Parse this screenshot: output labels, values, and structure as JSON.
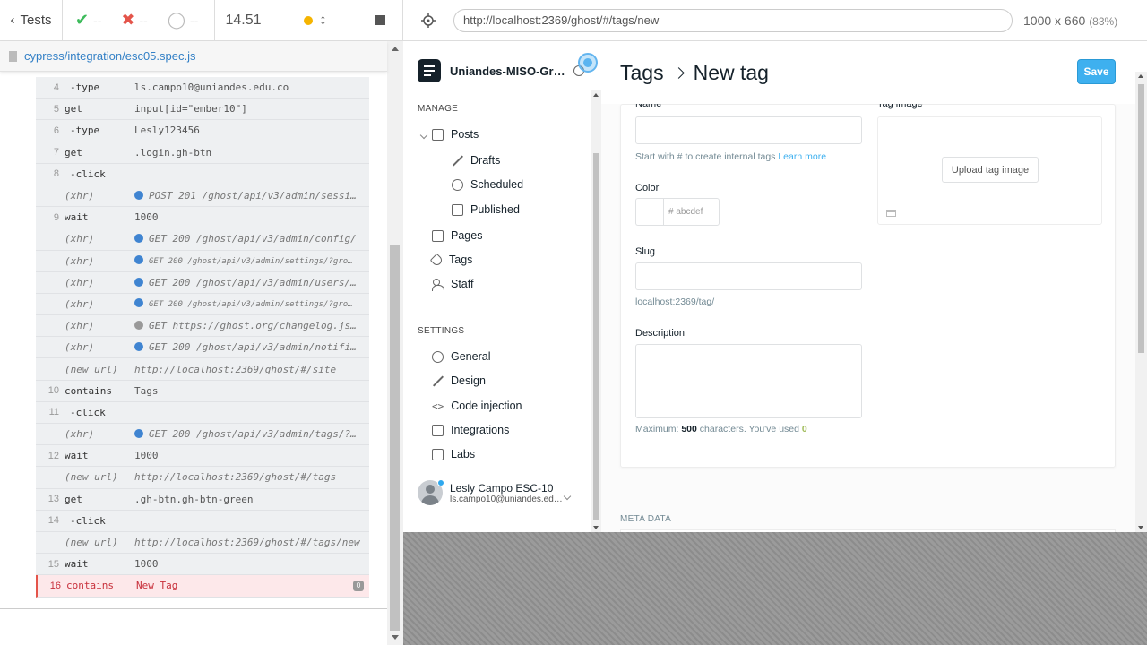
{
  "runner": {
    "tests_label": "Tests",
    "passed": "--",
    "failed": "--",
    "pending": "--",
    "duration": "14.51",
    "spec_path": "cypress/integration/esc05.spec.js"
  },
  "commands": [
    {
      "num": "4",
      "name": "-type",
      "msg": "ls.campo10@uniandes.edu.co",
      "kind": "child"
    },
    {
      "num": "5",
      "name": "get",
      "msg": "input[id=\"ember10\"]",
      "kind": "cmd"
    },
    {
      "num": "6",
      "name": "-type",
      "msg": "Lesly123456",
      "kind": "child"
    },
    {
      "num": "7",
      "name": "get",
      "msg": ".login.gh-btn",
      "kind": "cmd"
    },
    {
      "num": "8",
      "name": "-click",
      "msg": "",
      "kind": "child"
    },
    {
      "num": "",
      "name": "(xhr)",
      "msg": "POST 201 /ghost/api/v3/admin/sessi…",
      "kind": "xhr",
      "dot": "blue"
    },
    {
      "num": "9",
      "name": "wait",
      "msg": "1000",
      "kind": "cmd"
    },
    {
      "num": "",
      "name": "(xhr)",
      "msg": "GET 200 /ghost/api/v3/admin/config/",
      "kind": "xhr",
      "dot": "blue"
    },
    {
      "num": "",
      "name": "(xhr)",
      "msg": "GET 200 /ghost/api/v3/admin/settings/?gro…",
      "kind": "xhr-small",
      "dot": "blue"
    },
    {
      "num": "",
      "name": "(xhr)",
      "msg": "GET 200 /ghost/api/v3/admin/users/…",
      "kind": "xhr",
      "dot": "blue"
    },
    {
      "num": "",
      "name": "(xhr)",
      "msg": "GET 200 /ghost/api/v3/admin/settings/?gro…",
      "kind": "xhr-small",
      "dot": "blue"
    },
    {
      "num": "",
      "name": "(xhr)",
      "msg": "GET https://ghost.org/changelog.js…",
      "kind": "xhr",
      "dot": "gray"
    },
    {
      "num": "",
      "name": "(xhr)",
      "msg": "GET 200 /ghost/api/v3/admin/notifi…",
      "kind": "xhr",
      "dot": "blue"
    },
    {
      "num": "",
      "name": "(new url)",
      "msg": "http://localhost:2369/ghost/#/site",
      "kind": "url"
    },
    {
      "num": "10",
      "name": "contains",
      "msg": "Tags",
      "kind": "cmd"
    },
    {
      "num": "11",
      "name": "-click",
      "msg": "",
      "kind": "child"
    },
    {
      "num": "",
      "name": "(xhr)",
      "msg": "GET 200 /ghost/api/v3/admin/tags/?…",
      "kind": "xhr",
      "dot": "blue"
    },
    {
      "num": "12",
      "name": "wait",
      "msg": "1000",
      "kind": "cmd"
    },
    {
      "num": "",
      "name": "(new url)",
      "msg": "http://localhost:2369/ghost/#/tags",
      "kind": "url"
    },
    {
      "num": "13",
      "name": "get",
      "msg": ".gh-btn.gh-btn-green",
      "kind": "cmd"
    },
    {
      "num": "14",
      "name": "-click",
      "msg": "",
      "kind": "child"
    },
    {
      "num": "",
      "name": "(new url)",
      "msg": "http://localhost:2369/ghost/#/tags/new",
      "kind": "url"
    },
    {
      "num": "15",
      "name": "wait",
      "msg": "1000",
      "kind": "cmd"
    },
    {
      "num": "16",
      "name": "contains",
      "msg": "New Tag",
      "kind": "fail",
      "badge": "0"
    }
  ],
  "aut_header": {
    "url": "http://localhost:2369/ghost/#/tags/new",
    "viewport": "1000 x 660",
    "scale": "(83%)"
  },
  "ghost": {
    "site_title": "Uniandes-MISO-Gr…",
    "manage_label": "MANAGE",
    "settings_label": "SETTINGS",
    "nav": {
      "posts": "Posts",
      "drafts": "Drafts",
      "scheduled": "Scheduled",
      "published": "Published",
      "pages": "Pages",
      "tags": "Tags",
      "staff": "Staff",
      "general": "General",
      "design": "Design",
      "code_injection": "Code injection",
      "integrations": "Integrations",
      "labs": "Labs"
    },
    "user": {
      "name": "Lesly Campo ESC-10",
      "email": "ls.campo10@uniandes.ed…"
    },
    "breadcrumb_parent": "Tags",
    "page_title": "New tag",
    "save_label": "Save",
    "form": {
      "name_label": "Name",
      "name_value": "",
      "name_help_prefix": "Start with # to create internal tags",
      "name_help_link": "Learn more",
      "color_label": "Color",
      "color_placeholder": "# abcdef",
      "slug_label": "Slug",
      "slug_value": "",
      "slug_help": "localhost:2369/tag/",
      "description_label": "Description",
      "description_value": "",
      "desc_help_prefix": "Maximum:",
      "desc_help_max": "500",
      "desc_help_mid": "characters. You've used",
      "desc_help_used": "0",
      "tag_image_label": "Tag image",
      "upload_label": "Upload tag image"
    },
    "meta_label": "META DATA"
  },
  "colors": {
    "accent_blue": "#3eb0ef",
    "fail_red": "#e4544a",
    "pass_green": "#3dbb5b"
  }
}
